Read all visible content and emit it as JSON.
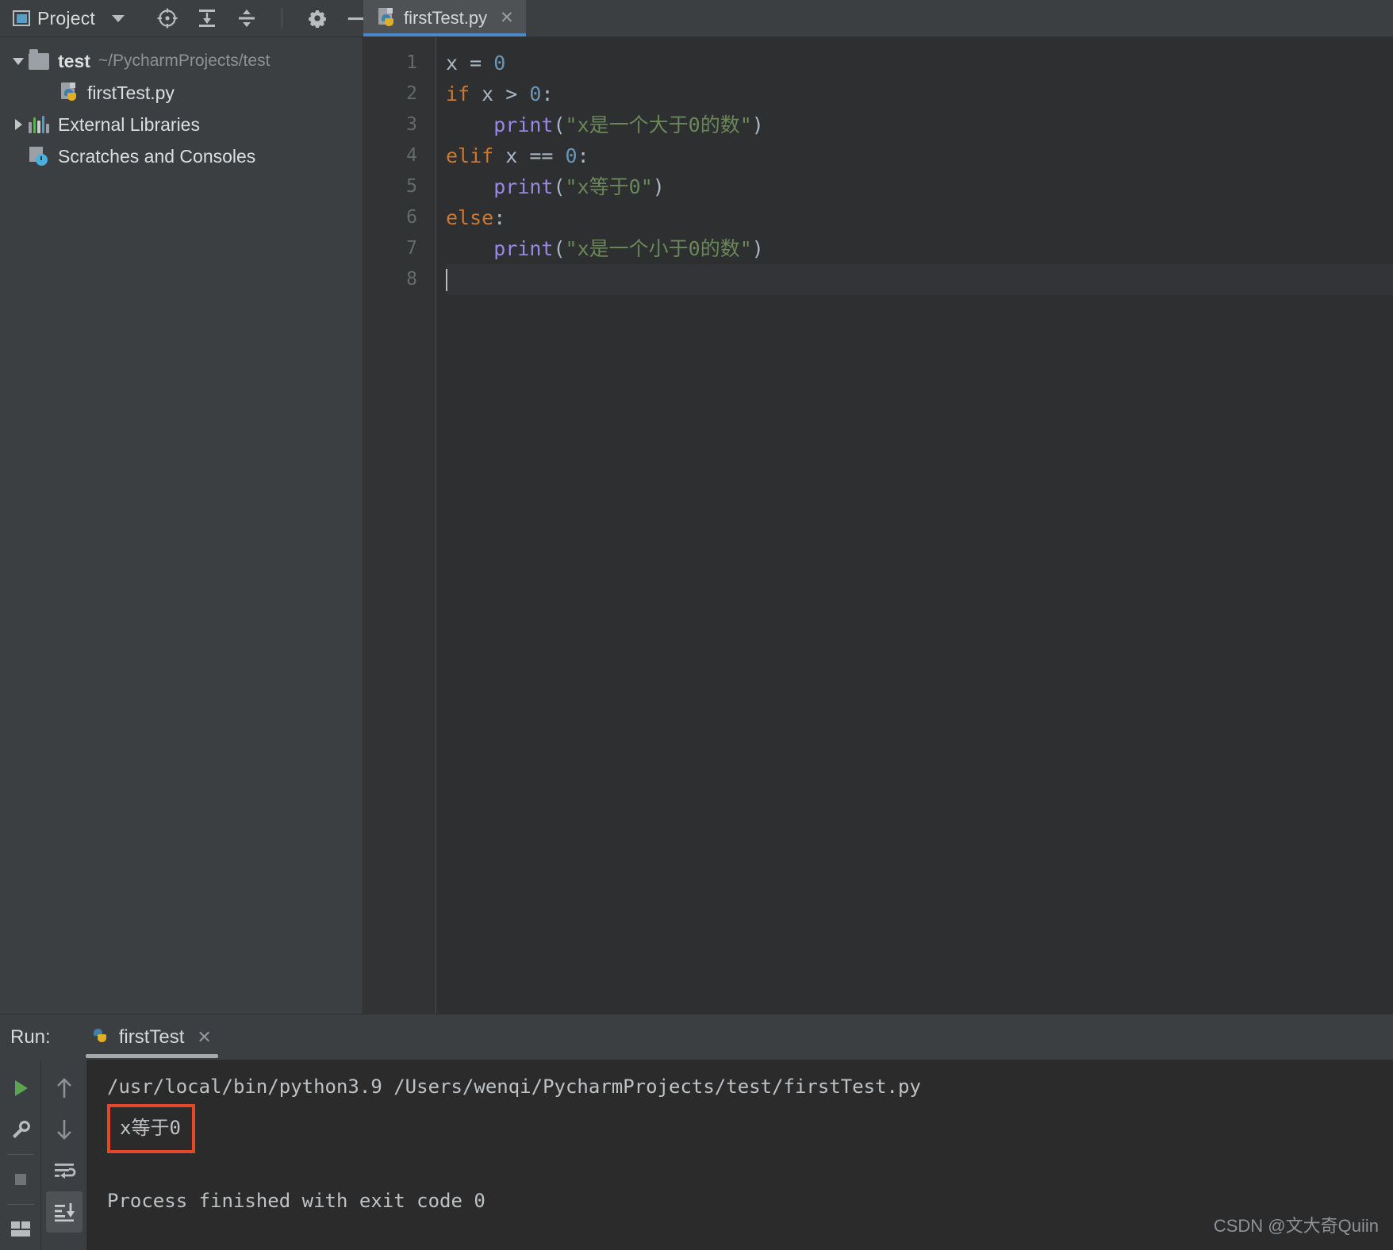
{
  "toolbar": {
    "project_label": "Project",
    "icons": [
      {
        "name": "locate-icon",
        "title": "Select Opened File"
      },
      {
        "name": "collapse-expand-icon",
        "title": "Expand All"
      },
      {
        "name": "collapse-all-icon",
        "title": "Collapse All"
      },
      {
        "name": "gear-icon",
        "title": "Settings"
      },
      {
        "name": "minimize-icon",
        "title": "Hide"
      }
    ]
  },
  "tabs": [
    {
      "label": "firstTest.py",
      "close": "✕",
      "active": true,
      "icon": "python-file-icon"
    }
  ],
  "sidebar": {
    "items": [
      {
        "name": "test",
        "path": "~/PycharmProjects/test",
        "type": "folder",
        "expanded": true,
        "indent": 0
      },
      {
        "name": "firstTest.py",
        "path": "",
        "type": "python",
        "expanded": false,
        "indent": 1
      },
      {
        "name": "External Libraries",
        "path": "",
        "type": "libraries",
        "expanded": false,
        "indent": 0
      },
      {
        "name": "Scratches and Consoles",
        "path": "",
        "type": "scratches",
        "expanded": false,
        "indent": 0
      }
    ]
  },
  "editor": {
    "line_numbers": [
      "1",
      "2",
      "3",
      "4",
      "5",
      "6",
      "7",
      "8"
    ],
    "code": [
      {
        "n": 1,
        "tokens": [
          {
            "t": "x ",
            "c": "pl"
          },
          {
            "t": "= ",
            "c": "pl"
          },
          {
            "t": "0",
            "c": "num"
          }
        ]
      },
      {
        "n": 2,
        "tokens": [
          {
            "t": "if",
            "c": "kw"
          },
          {
            "t": " x > ",
            "c": "pl"
          },
          {
            "t": "0",
            "c": "num"
          },
          {
            "t": ":",
            "c": "pl"
          }
        ]
      },
      {
        "n": 3,
        "tokens": [
          {
            "t": "    ",
            "c": "pl"
          },
          {
            "t": "print",
            "c": "fn"
          },
          {
            "t": "(",
            "c": "pl"
          },
          {
            "t": "\"x是一个大于0的数\"",
            "c": "str"
          },
          {
            "t": ")",
            "c": "pl"
          }
        ]
      },
      {
        "n": 4,
        "tokens": [
          {
            "t": "elif",
            "c": "kw"
          },
          {
            "t": " x == ",
            "c": "pl"
          },
          {
            "t": "0",
            "c": "num"
          },
          {
            "t": ":",
            "c": "pl"
          }
        ]
      },
      {
        "n": 5,
        "tokens": [
          {
            "t": "    ",
            "c": "pl"
          },
          {
            "t": "print",
            "c": "fn"
          },
          {
            "t": "(",
            "c": "pl"
          },
          {
            "t": "\"x等于0\"",
            "c": "str"
          },
          {
            "t": ")",
            "c": "pl"
          }
        ]
      },
      {
        "n": 6,
        "tokens": [
          {
            "t": "else",
            "c": "kw"
          },
          {
            "t": ":",
            "c": "pl"
          }
        ]
      },
      {
        "n": 7,
        "tokens": [
          {
            "t": "    ",
            "c": "pl"
          },
          {
            "t": "print",
            "c": "fn"
          },
          {
            "t": "(",
            "c": "pl"
          },
          {
            "t": "\"x是一个小于0的数\"",
            "c": "str"
          },
          {
            "t": ")",
            "c": "pl"
          }
        ]
      },
      {
        "n": 8,
        "tokens": [],
        "caret": true
      }
    ],
    "plain_text": "x = 0\nif x > 0:\n    print(\"x是一个大于0的数\")\nelif x == 0:\n    print(\"x等于0\")\nelse:\n    print(\"x是一个小于0的数\")\n",
    "colors": {
      "keyword": "#cc7832",
      "number": "#6897bb",
      "string": "#6a8759",
      "function": "#9b86ea",
      "plain": "#a9b7c6",
      "background": "#2e2f30",
      "gutter_bg": "#313335"
    }
  },
  "run_panel": {
    "run_word": "Run:",
    "tab_label": "firstTest",
    "tab_close": "✕",
    "tools_left": [
      {
        "name": "run-button",
        "glyph": "play"
      },
      {
        "name": "wrench-icon",
        "glyph": "wrench"
      },
      {
        "name": "stop-button",
        "glyph": "stop"
      },
      {
        "name": "layout-icon",
        "glyph": "layout"
      }
    ],
    "tools_right": [
      {
        "name": "scroll-up-button",
        "glyph": "arrow-up"
      },
      {
        "name": "scroll-down-button",
        "glyph": "arrow-down"
      },
      {
        "name": "soft-wrap-button",
        "glyph": "wrap"
      },
      {
        "name": "scroll-to-end-button",
        "glyph": "scroll-end",
        "active": true
      }
    ],
    "console_lines": [
      {
        "text": "/usr/local/bin/python3.9 /Users/wenqi/PycharmProjects/test/firstTest.py",
        "highlight": false
      },
      {
        "text": "x等于0",
        "highlight": true
      },
      {
        "text": "",
        "highlight": false
      },
      {
        "text": "Process finished with exit code 0",
        "highlight": false
      }
    ],
    "highlight_color": "#e8462a"
  },
  "watermark": "CSDN @文大奇Quiin"
}
